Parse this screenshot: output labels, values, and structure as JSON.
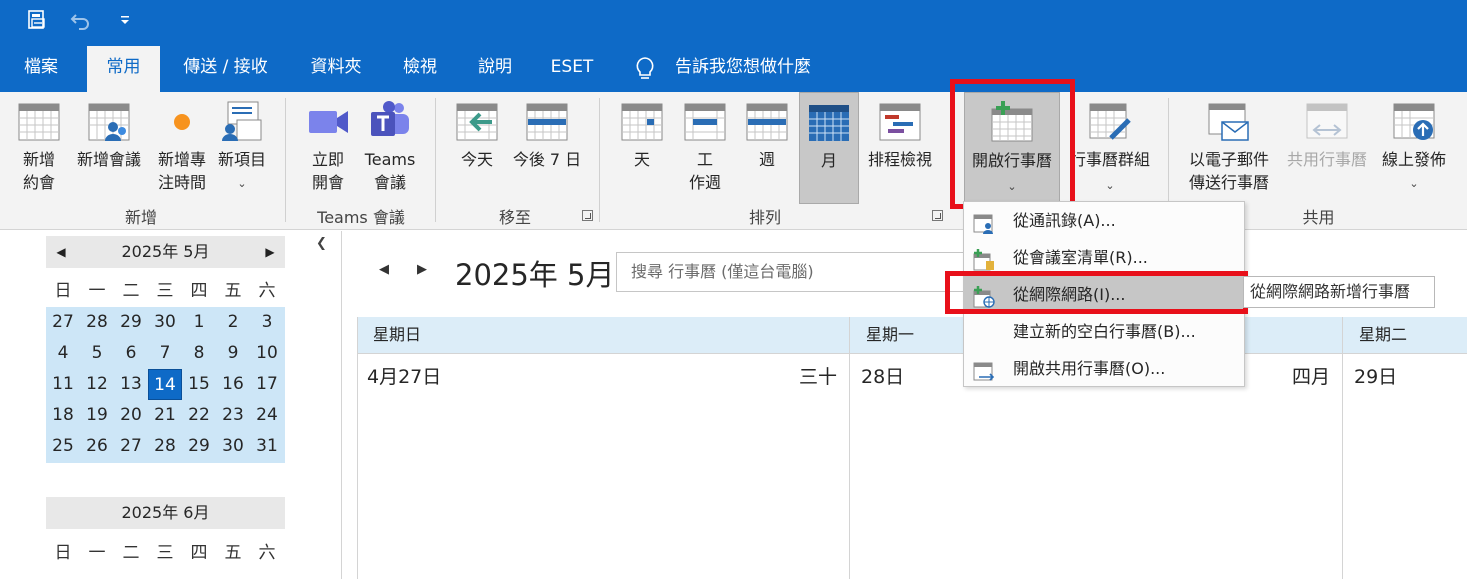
{
  "quick_access": {
    "icons": [
      "send-receive-icon",
      "undo-icon",
      "customize-qat-icon"
    ]
  },
  "tabs": [
    {
      "label": "檔案",
      "active": false
    },
    {
      "label": "常用",
      "active": true
    },
    {
      "label": "傳送 / 接收",
      "active": false
    },
    {
      "label": "資料夾",
      "active": false
    },
    {
      "label": "檢視",
      "active": false
    },
    {
      "label": "說明",
      "active": false
    },
    {
      "label": "ESET",
      "active": false
    }
  ],
  "tell_me": "告訴我您想做什麼",
  "ribbon": {
    "groups": {
      "new": "新增",
      "teams": "Teams 會議",
      "goto": "移至",
      "arrange": "排列",
      "share": "共用"
    },
    "buttons": {
      "new_appointment": "新增\n約會",
      "new_meeting": "新增會議",
      "new_focus_time": "新增專\n注時間",
      "new_items": "新項目",
      "meet_now": "立即\n開會",
      "teams_meeting": "Teams\n會議",
      "today": "今天",
      "next_7_days": "今後 7 日",
      "day": "天",
      "work_week": "工\n作週",
      "week": "週",
      "month": "月",
      "schedule_view": "排程檢視",
      "open_calendar": "開啟行事曆",
      "calendar_groups": "行事曆群組",
      "email_calendar": "以電子郵件\n傳送行事曆",
      "share_calendar": "共用行事曆",
      "publish_online": "線上發佈"
    }
  },
  "open_calendar_menu": {
    "items": [
      {
        "label": "從通訊錄(A)...",
        "highlighted": false
      },
      {
        "label": "從會議室清單(R)...",
        "highlighted": false
      },
      {
        "label": "從網際網路(I)...",
        "highlighted": true
      },
      {
        "label": "建立新的空白行事曆(B)...",
        "highlighted": false
      },
      {
        "label": "開啟共用行事曆(O)...",
        "highlighted": false
      }
    ],
    "tooltip": "從網際網路新增行事曆"
  },
  "mini_calendars": [
    {
      "title": "2025年 5月",
      "weekdays": [
        "日",
        "一",
        "二",
        "三",
        "四",
        "五",
        "六"
      ],
      "days": [
        [
          "27",
          "28",
          "29",
          "30",
          "1",
          "2",
          "3"
        ],
        [
          "4",
          "5",
          "6",
          "7",
          "8",
          "9",
          "10"
        ],
        [
          "11",
          "12",
          "13",
          "14",
          "15",
          "16",
          "17"
        ],
        [
          "18",
          "19",
          "20",
          "21",
          "22",
          "23",
          "24"
        ],
        [
          "25",
          "26",
          "27",
          "28",
          "29",
          "30",
          "31"
        ]
      ],
      "today": "14"
    },
    {
      "title": "2025年 6月",
      "weekdays": [
        "日",
        "一",
        "二",
        "三",
        "四",
        "五",
        "六"
      ]
    }
  ],
  "main": {
    "month_title": "2025年 5月",
    "search_placeholder": "搜尋 行事曆 (僅這台電腦)",
    "day_headers": [
      "星期日",
      "星期一",
      "星期二"
    ],
    "first_row": [
      {
        "date": "4月27日",
        "lunar": "三十"
      },
      {
        "date": "28日",
        "lunar": "四月"
      },
      {
        "date": "29日",
        "lunar": ""
      }
    ]
  },
  "colors": {
    "accent": "#0e6ac7",
    "ribbon_bg": "#f3f3f3",
    "highlight_box": "#e8101a",
    "minical_bg": "#cde6f7",
    "dayheader_bg": "#dcedf8"
  }
}
